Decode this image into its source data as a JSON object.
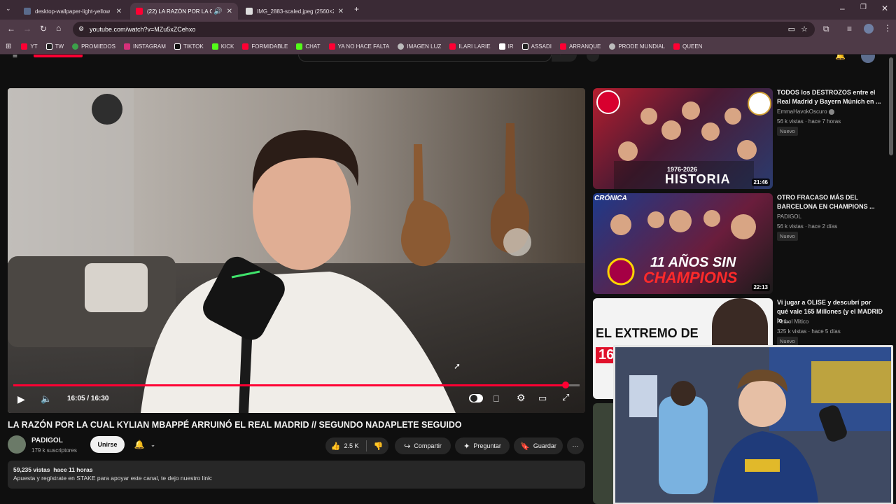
{
  "tabs": [
    {
      "title": "desktop-wallpaper-light-yellow",
      "favicon_color": "#5a6b8c"
    },
    {
      "title": "(22) LA RAZÓN POR LA CUA",
      "favicon_color": "#ff0033"
    },
    {
      "title": "IMG_2883-scaled.jpeg (2560×2",
      "favicon_color": "#dddddd"
    }
  ],
  "url": "youtube.com/watch?v=MZu5xZCehxo",
  "bookmarks": [
    {
      "label": "YT",
      "color": "#ff0033"
    },
    {
      "label": "TW",
      "color": "#ffffff"
    },
    {
      "label": "PROMIEDOS",
      "color": "#3ca04a"
    },
    {
      "label": "INSTAGRAM",
      "color": "#d6307a"
    },
    {
      "label": "TIKTOK",
      "color": "#ffffff"
    },
    {
      "label": "KICK",
      "color": "#53fc18"
    },
    {
      "label": "FORMIDABLE",
      "color": "#ff0033"
    },
    {
      "label": "CHAT",
      "color": "#53fc18"
    },
    {
      "label": "YA NO HACE FALTA",
      "color": "#ff0033"
    },
    {
      "label": "IMAGEN LUZ",
      "color": "#cccccc"
    },
    {
      "label": "ILARI LARIE",
      "color": "#ff0033"
    },
    {
      "label": "IR",
      "color": "#ffffff"
    },
    {
      "label": "ASSADI",
      "color": "#ffffff"
    },
    {
      "label": "ARRANQUE",
      "color": "#ff0033"
    },
    {
      "label": "PRODE MUNDIAL",
      "color": "#cccccc"
    },
    {
      "label": "QUEEN",
      "color": "#ff0033"
    }
  ],
  "player": {
    "time": "16:05 / 16:30",
    "progress": 0.975,
    "accent": "#ff0033"
  },
  "video": {
    "title": "LA RAZÓN POR LA CUAL KYLIAN MBAPPÉ ARRUINÓ EL REAL MADRID // SEGUNDO NADAPLETE SEGUIDO",
    "channel": "PADIGOL",
    "subscribers": "179 k suscriptores",
    "join_label": "Unirse",
    "likes": "2.5 K",
    "share_label": "Compartir",
    "ask_label": "Preguntar",
    "save_label": "Guardar",
    "views": "59,235 vistas",
    "age": "hace 11 horas",
    "description": "Apuesta y regístrate en STAKE para apoyar este canal, te dejo nuestro link:"
  },
  "recommendations": [
    {
      "title": "TODOS los DESTROZOS entre el Real Madrid y Bayern Múnich en ...",
      "channel": "EmmaHavokOscuro",
      "verified": true,
      "meta": "56 k vistas · hace 7 horas",
      "badge": "Nuevo",
      "duration": "21:46",
      "thumb_caption": "1976-2026",
      "thumb_text": "HISTORIA"
    },
    {
      "title": "OTRO FRACASO MÁS DEL BARCELONA EN CHAMPIONS ...",
      "channel": "PADIGOL",
      "verified": false,
      "meta": "56 k vistas · hace 2 días",
      "badge": "Nuevo",
      "duration": "22:13",
      "thumb_caption": "CRÓNICA",
      "thumb_text": "11 AÑOS SIN",
      "thumb_text2": "CHAMPIONS"
    },
    {
      "title": "Vi jugar a OLISE y descubrí por qué vale 165 Millones (y el MADRID lo ...",
      "channel": "Futbol Mitico",
      "verified": false,
      "meta": "325 k vistas · hace 5 días",
      "badge": "Nuevo",
      "duration": "",
      "thumb_text": "EL EXTREMO DE",
      "thumb_text2": "16"
    }
  ]
}
